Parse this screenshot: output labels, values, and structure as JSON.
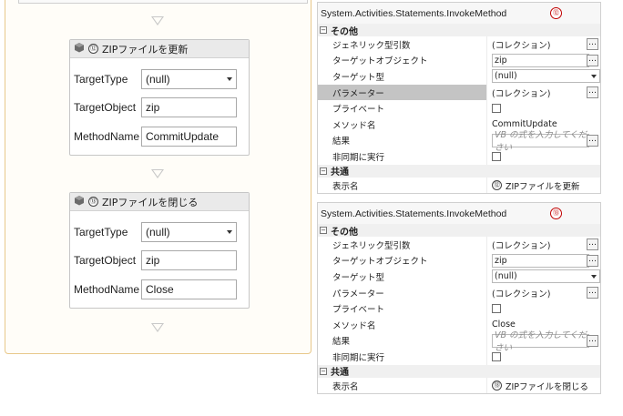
{
  "designer": {
    "activities": [
      {
        "badge": "⑫",
        "title": "ZIPファイルを更新",
        "fields": [
          {
            "label": "TargetType",
            "value": "(null)"
          },
          {
            "label": "TargetObject",
            "value": "zip"
          },
          {
            "label": "MethodName",
            "value": "CommitUpdate"
          }
        ]
      },
      {
        "badge": "⑬",
        "title": "ZIPファイルを閉じる",
        "fields": [
          {
            "label": "TargetType",
            "value": "(null)"
          },
          {
            "label": "TargetObject",
            "value": "zip"
          },
          {
            "label": "MethodName",
            "value": "Close"
          }
        ]
      }
    ]
  },
  "grids": [
    {
      "title": "System.Activities.Statements.InvokeMethod",
      "step_marker": "⑫",
      "misc_category": "その他",
      "common_category": "共通",
      "rows": [
        {
          "name": "ジェネリック型引数",
          "value": "(コレクション)"
        },
        {
          "name": "ターゲットオブジェクト",
          "value": "zip"
        },
        {
          "name": "ターゲット型",
          "value": "(null)"
        },
        {
          "name": "パラメーター",
          "value": "(コレクション)"
        },
        {
          "name": "プライベート",
          "value": ""
        },
        {
          "name": "メソッド名",
          "value": "CommitUpdate"
        },
        {
          "name": "結果",
          "placeholder": "VB の式を入力してください"
        },
        {
          "name": "非同期に実行",
          "value": ""
        }
      ],
      "display_name": {
        "name": "表示名",
        "badge": "⑫",
        "value": "ZIPファイルを更新"
      }
    },
    {
      "title": "System.Activities.Statements.InvokeMethod",
      "step_marker": "⑬",
      "misc_category": "その他",
      "common_category": "共通",
      "rows": [
        {
          "name": "ジェネリック型引数",
          "value": "(コレクション)"
        },
        {
          "name": "ターゲットオブジェクト",
          "value": "zip"
        },
        {
          "name": "ターゲット型",
          "value": "(null)"
        },
        {
          "name": "パラメーター",
          "value": "(コレクション)"
        },
        {
          "name": "プライベート",
          "value": ""
        },
        {
          "name": "メソッド名",
          "value": "Close"
        },
        {
          "name": "結果",
          "placeholder": "VB の式を入力してください"
        },
        {
          "name": "非同期に実行",
          "value": ""
        }
      ],
      "display_name": {
        "name": "表示名",
        "badge": "⑬",
        "value": "ZIPファイルを閉じる"
      }
    }
  ]
}
